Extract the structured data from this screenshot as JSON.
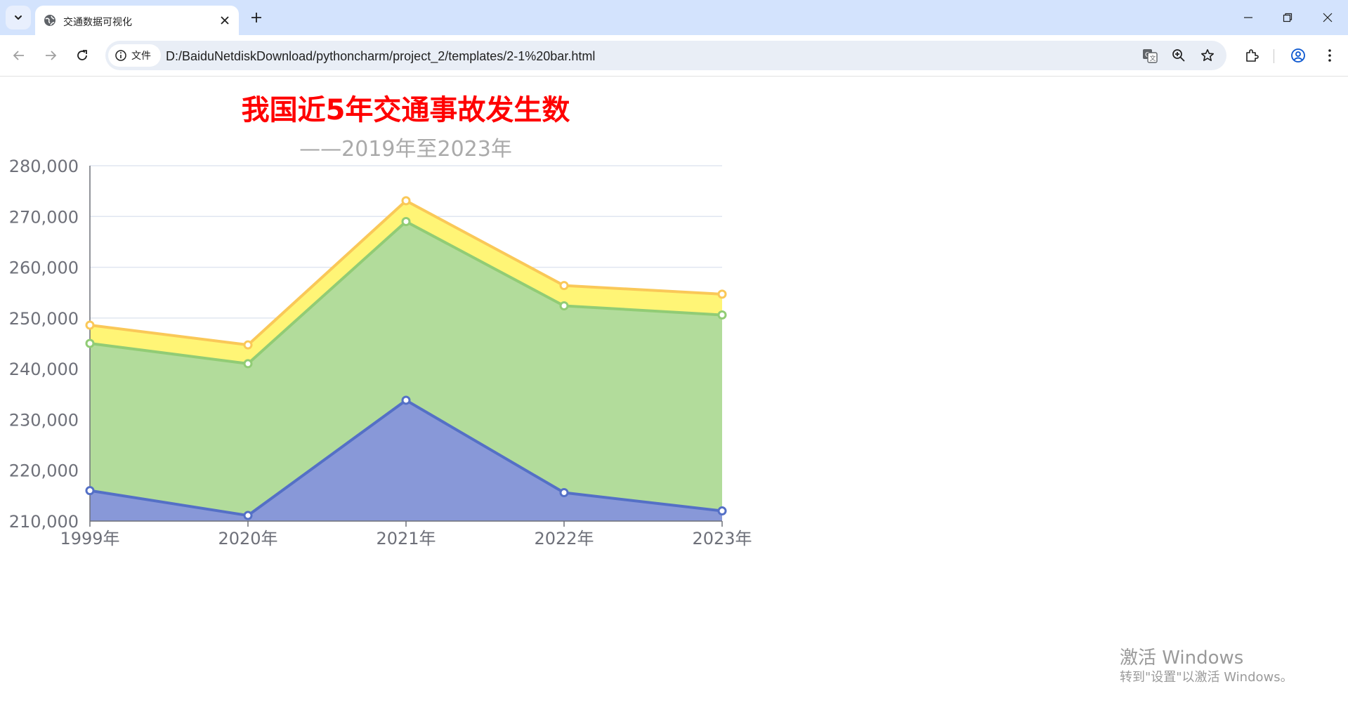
{
  "browser": {
    "tab_title": "交通数据可视化",
    "site_chip_label": "文件",
    "url": "D:/BaiduNetdiskDownload/pythoncharm/project_2/templates/2-1%20bar.html"
  },
  "page": {
    "title": "我国近5年交通事故发生数",
    "subtitle": "——2019年至2023年"
  },
  "chart_data": {
    "type": "area",
    "stacked": false,
    "title": "我国近5年交通事故发生数",
    "subtitle": "——2019年至2023年",
    "categories": [
      "1999年",
      "2020年",
      "2021年",
      "2022年",
      "2023年"
    ],
    "ylim": [
      210000,
      280000
    ],
    "y_ticks": [
      210000,
      220000,
      230000,
      240000,
      250000,
      260000,
      270000,
      280000
    ],
    "y_tick_labels": [
      "210,000",
      "220,000",
      "230,000",
      "240,000",
      "250,000",
      "260,000",
      "270,000",
      "280,000"
    ],
    "grid": true,
    "legend": "none",
    "series": [
      {
        "values": [
          248600,
          244700,
          273100,
          256400,
          254700
        ],
        "color": "#fac858",
        "fill": "#fff576"
      },
      {
        "values": [
          245000,
          241000,
          269000,
          252400,
          250600
        ],
        "color": "#91cc75",
        "fill": "#b2dc9b"
      },
      {
        "values": [
          216000,
          211100,
          233800,
          215600,
          212000
        ],
        "color": "#5470c6",
        "fill": "#8898d8"
      }
    ]
  },
  "watermark": {
    "title": "激活 Windows",
    "subtitle": "转到\"设置\"以激活 Windows。"
  }
}
